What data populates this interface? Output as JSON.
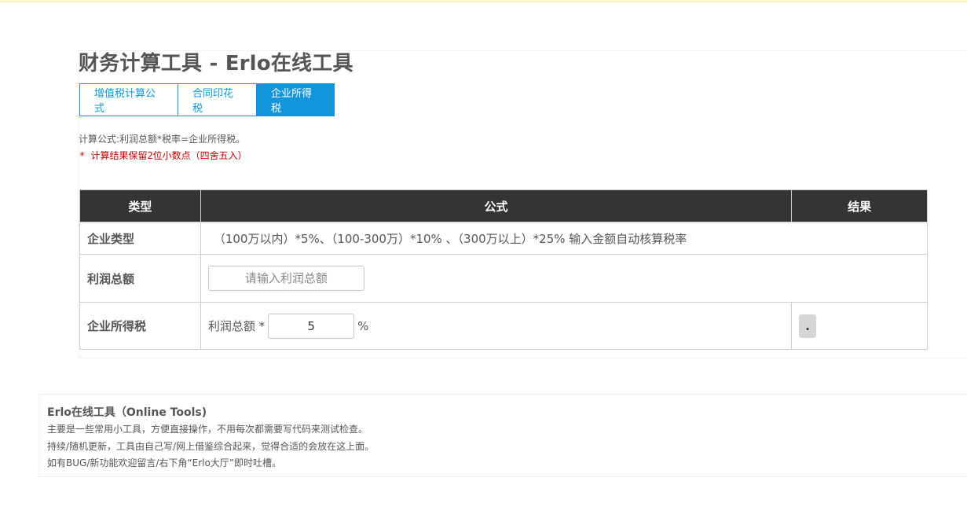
{
  "page": {
    "title": "财务计算工具 - Erlo在线工具"
  },
  "tabs": [
    {
      "label": "增值税计算公式",
      "active": false
    },
    {
      "label": "合同印花税",
      "active": false
    },
    {
      "label": "企业所得税",
      "active": true
    }
  ],
  "notes": {
    "formula": "计算公式:利润总额*税率=企业所得税。",
    "rounding": "* 计算结果保留2位小数点（四舍五入）"
  },
  "table": {
    "headers": [
      "类型",
      "公式",
      "结果"
    ],
    "rows": {
      "enterprise_type": {
        "label": "企业类型",
        "text": "（100万以内）*5%、（100-300万）*10% 、（300万以上）*25% 输入金额自动核算税率"
      },
      "total_profit": {
        "label": "利润总额",
        "placeholder": "请输入利润总额",
        "value": ""
      },
      "income_tax": {
        "label": "企业所得税",
        "prefix": "利润总额 *",
        "rate_value": "5",
        "suffix": "%",
        "result": "."
      }
    }
  },
  "about": {
    "title": "Erlo在线工具（Online Tools)",
    "lines": [
      "主要是一些常用小工具，方便直接操作，不用每次都需要写代码来测试检查。",
      "持续/随机更新，工具由自己写/网上借鉴综合起来，觉得合适的会放在这上面。",
      "如有BUG/新功能欢迎留言/右下角“Erlo大厅”即时吐槽。"
    ]
  },
  "colors": {
    "accent": "#1296db",
    "header_bg": "#343434",
    "warning": "#c00000"
  }
}
